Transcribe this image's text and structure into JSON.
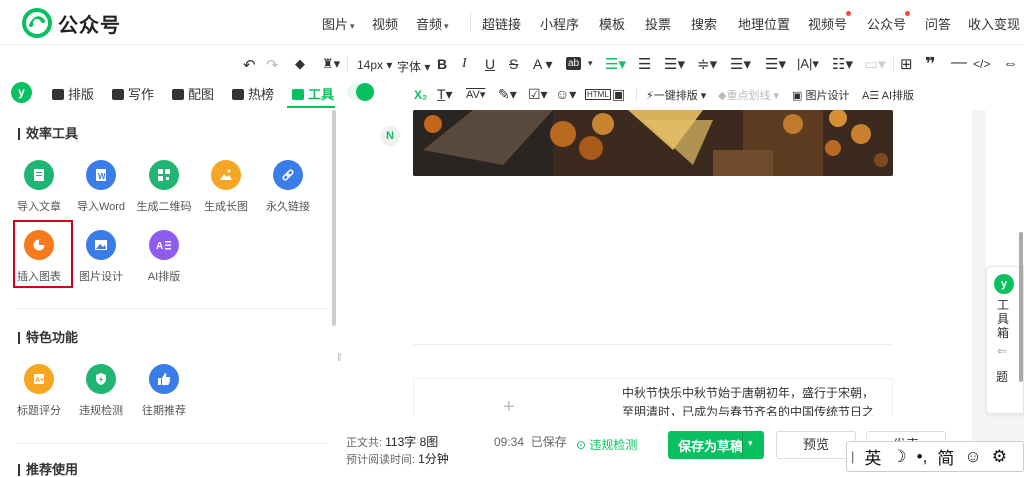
{
  "app": {
    "logo_text": "公众号"
  },
  "top_menu": {
    "items": [
      {
        "label": "图片",
        "dropdown": true
      },
      {
        "label": "视频",
        "dropdown": false
      },
      {
        "label": "音频",
        "dropdown": true
      },
      {
        "label": "超链接",
        "dropdown": false
      },
      {
        "label": "小程序",
        "dropdown": false
      },
      {
        "label": "模板",
        "dropdown": false
      },
      {
        "label": "投票",
        "dropdown": false
      },
      {
        "label": "搜索",
        "dropdown": false
      },
      {
        "label": "地理位置",
        "dropdown": false
      },
      {
        "label": "视频号",
        "dropdown": false,
        "badge": true
      },
      {
        "label": "公众号",
        "dropdown": false,
        "badge": true
      },
      {
        "label": "问答",
        "dropdown": false
      },
      {
        "label": "收入变现",
        "dropdown": false
      }
    ]
  },
  "toolbar": {
    "font_size": "14px",
    "font_family": "字体",
    "one_click_layout": "一键排版",
    "highlight_line": "重点划线",
    "image_design": "图片设计",
    "ai_layout": "AI排版"
  },
  "left_tabs": [
    {
      "label": "排版"
    },
    {
      "label": "写作"
    },
    {
      "label": "配图"
    },
    {
      "label": "热榜"
    },
    {
      "label": "工具",
      "active": true
    }
  ],
  "sections": {
    "efficiency": {
      "title": "效率工具",
      "tools": [
        {
          "label": "导入文章",
          "color": "#21b573",
          "icon": "document-icon"
        },
        {
          "label": "导入Word",
          "color": "#3a7de8",
          "icon": "word-icon"
        },
        {
          "label": "生成二维码",
          "color": "#21b573",
          "icon": "qrcode-icon"
        },
        {
          "label": "生成长图",
          "color": "#f5a623",
          "icon": "image-icon"
        },
        {
          "label": "永久链接",
          "color": "#3a7de8",
          "icon": "link-icon"
        },
        {
          "label": "插入图表",
          "color": "#f77b1c",
          "icon": "pie-chart-icon"
        },
        {
          "label": "图片设计",
          "color": "#3a7de8",
          "icon": "picture-icon"
        },
        {
          "label": "AI排版",
          "color": "#8e5cf0",
          "icon": "ai-icon"
        }
      ]
    },
    "special": {
      "title": "特色功能",
      "tools": [
        {
          "label": "标题评分",
          "color": "#f5a623",
          "icon": "score-icon"
        },
        {
          "label": "违规检测",
          "color": "#21b573",
          "icon": "shield-icon"
        },
        {
          "label": "往期推荐",
          "color": "#3a7de8",
          "icon": "thumbs-up-icon"
        }
      ]
    },
    "recommend": {
      "title": "推荐使用"
    }
  },
  "editor": {
    "paragraph": "中秋节快乐中秋节始于唐朝初年，盛行于宋朝，至明清时，已成为与春节齐名的中国传统节日之一。"
  },
  "bottom_bar": {
    "word_count_label": "正文共:",
    "word_count": "113字 8图",
    "read_time_label": "预计阅读时间:",
    "read_time": "1分钟",
    "saved_time": "09:34",
    "saved_label": "已保存",
    "check_label": "违规检测",
    "save_draft": "保存为草稿",
    "preview": "预览",
    "publish": "发表"
  },
  "right_panel": {
    "toolbox": "工具箱",
    "next_label": "题"
  },
  "ime": {
    "lang": "英",
    "mode": "简"
  },
  "colors": {
    "accent": "#07c160",
    "highlight_border": "#d0021b"
  }
}
